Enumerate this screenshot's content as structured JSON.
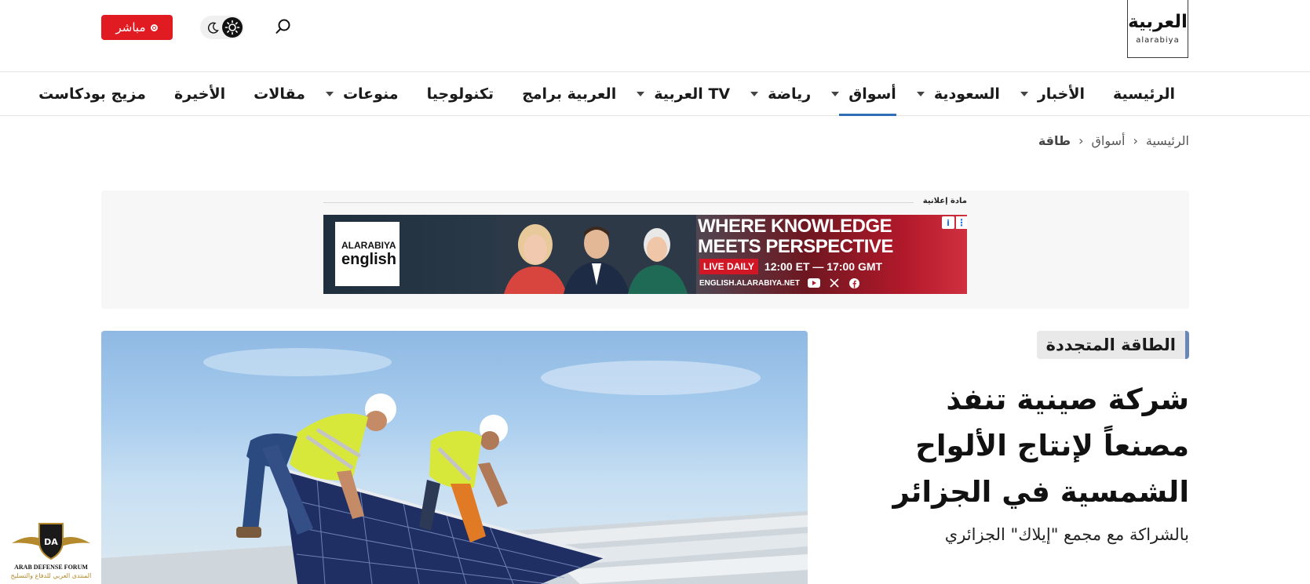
{
  "header": {
    "logo_ar": "العربية",
    "logo_en": "alarabiya",
    "live_label": "مباشر"
  },
  "nav": {
    "items": [
      {
        "label": "الرئيسية",
        "caret": false,
        "active": false
      },
      {
        "label": "الأخبار",
        "caret": true,
        "active": false
      },
      {
        "label": "السعودية",
        "caret": true,
        "active": false
      },
      {
        "label": "أسواق",
        "caret": true,
        "active": true
      },
      {
        "label": "رياضة",
        "caret": true,
        "active": false
      },
      {
        "label": "العربية TV",
        "caret": true,
        "active": false
      },
      {
        "label": "العربية برامج",
        "caret": false,
        "active": false
      },
      {
        "label": "تكنولوجيا",
        "caret": false,
        "active": false
      },
      {
        "label": "منوعات",
        "caret": true,
        "active": false
      },
      {
        "label": "مقالات",
        "caret": false,
        "active": false
      },
      {
        "label": "الأخيرة",
        "caret": false,
        "active": false
      },
      {
        "label": "مزيج بودكاست",
        "caret": false,
        "active": false
      }
    ]
  },
  "breadcrumb": {
    "home": "الرئيسية",
    "section": "أسواق",
    "current": "طاقة"
  },
  "ad": {
    "label": "مادة إعلانية",
    "logo_line1": "ALARABIYA",
    "logo_line2": "english",
    "headline_1": "WHERE KNOWLEDGE",
    "headline_2": "MEETS PERSPECTIVE",
    "live_daily": "LIVE DAILY",
    "time": "12:00 ET — 17:00 GMT",
    "url": "ENGLISH.ALARABIYA.NET"
  },
  "article": {
    "tag": "الطاقة المتجددة",
    "title": "شركة صينية تنفذ مصنعاً لإنتاج الألواح الشمسية في الجزائر",
    "subtitle": "بالشراكة مع مجمع \"إيلاك\" الجزائري"
  },
  "watermark": {
    "line1": "ARAB DEFENSE FORUM",
    "line2": "المنتدى العربي للدفاع والتسليح",
    "badge": "DA"
  },
  "colors": {
    "live_red": "#e01b22",
    "nav_active_underline": "#2f6db5",
    "tag_accent": "#6b87b8"
  }
}
